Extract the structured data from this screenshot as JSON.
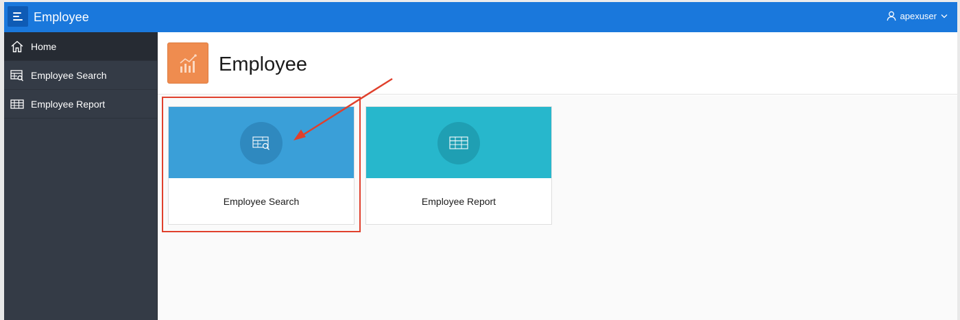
{
  "header": {
    "app_title": "Employee",
    "user_name": "apexuser",
    "accent_color": "#1a78dc"
  },
  "sidebar": {
    "items": [
      {
        "label": "Home",
        "icon": "home-icon",
        "active": true
      },
      {
        "label": "Employee Search",
        "icon": "table-search-icon",
        "active": false
      },
      {
        "label": "Employee Report",
        "icon": "table-icon",
        "active": false
      }
    ]
  },
  "page": {
    "title": "Employee",
    "icon": "chart-trend-icon",
    "icon_color": "#ef8c4f"
  },
  "cards": [
    {
      "label": "Employee Search",
      "icon": "table-search-icon",
      "color": "#3a9fd8"
    },
    {
      "label": "Employee Report",
      "icon": "table-icon",
      "color": "#27b7cc"
    }
  ],
  "annotation": {
    "color": "#e0402c",
    "target": "Employee Search"
  }
}
